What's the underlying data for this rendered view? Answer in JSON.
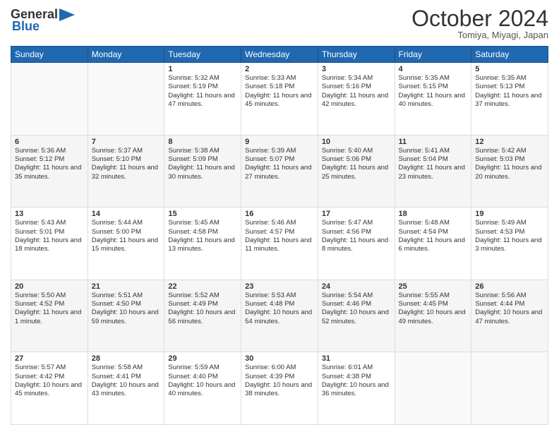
{
  "header": {
    "logo_general": "General",
    "logo_blue": "Blue",
    "month_title": "October 2024",
    "subtitle": "Tomiya, Miyagi, Japan"
  },
  "weekdays": [
    "Sunday",
    "Monday",
    "Tuesday",
    "Wednesday",
    "Thursday",
    "Friday",
    "Saturday"
  ],
  "weeks": [
    [
      {
        "day": "",
        "info": ""
      },
      {
        "day": "",
        "info": ""
      },
      {
        "day": "1",
        "info": "Sunrise: 5:32 AM\nSunset: 5:19 PM\nDaylight: 11 hours and 47 minutes."
      },
      {
        "day": "2",
        "info": "Sunrise: 5:33 AM\nSunset: 5:18 PM\nDaylight: 11 hours and 45 minutes."
      },
      {
        "day": "3",
        "info": "Sunrise: 5:34 AM\nSunset: 5:16 PM\nDaylight: 11 hours and 42 minutes."
      },
      {
        "day": "4",
        "info": "Sunrise: 5:35 AM\nSunset: 5:15 PM\nDaylight: 11 hours and 40 minutes."
      },
      {
        "day": "5",
        "info": "Sunrise: 5:35 AM\nSunset: 5:13 PM\nDaylight: 11 hours and 37 minutes."
      }
    ],
    [
      {
        "day": "6",
        "info": "Sunrise: 5:36 AM\nSunset: 5:12 PM\nDaylight: 11 hours and 35 minutes."
      },
      {
        "day": "7",
        "info": "Sunrise: 5:37 AM\nSunset: 5:10 PM\nDaylight: 11 hours and 32 minutes."
      },
      {
        "day": "8",
        "info": "Sunrise: 5:38 AM\nSunset: 5:09 PM\nDaylight: 11 hours and 30 minutes."
      },
      {
        "day": "9",
        "info": "Sunrise: 5:39 AM\nSunset: 5:07 PM\nDaylight: 11 hours and 27 minutes."
      },
      {
        "day": "10",
        "info": "Sunrise: 5:40 AM\nSunset: 5:06 PM\nDaylight: 11 hours and 25 minutes."
      },
      {
        "day": "11",
        "info": "Sunrise: 5:41 AM\nSunset: 5:04 PM\nDaylight: 11 hours and 23 minutes."
      },
      {
        "day": "12",
        "info": "Sunrise: 5:42 AM\nSunset: 5:03 PM\nDaylight: 11 hours and 20 minutes."
      }
    ],
    [
      {
        "day": "13",
        "info": "Sunrise: 5:43 AM\nSunset: 5:01 PM\nDaylight: 11 hours and 18 minutes."
      },
      {
        "day": "14",
        "info": "Sunrise: 5:44 AM\nSunset: 5:00 PM\nDaylight: 11 hours and 15 minutes."
      },
      {
        "day": "15",
        "info": "Sunrise: 5:45 AM\nSunset: 4:58 PM\nDaylight: 11 hours and 13 minutes."
      },
      {
        "day": "16",
        "info": "Sunrise: 5:46 AM\nSunset: 4:57 PM\nDaylight: 11 hours and 11 minutes."
      },
      {
        "day": "17",
        "info": "Sunrise: 5:47 AM\nSunset: 4:56 PM\nDaylight: 11 hours and 8 minutes."
      },
      {
        "day": "18",
        "info": "Sunrise: 5:48 AM\nSunset: 4:54 PM\nDaylight: 11 hours and 6 minutes."
      },
      {
        "day": "19",
        "info": "Sunrise: 5:49 AM\nSunset: 4:53 PM\nDaylight: 11 hours and 3 minutes."
      }
    ],
    [
      {
        "day": "20",
        "info": "Sunrise: 5:50 AM\nSunset: 4:52 PM\nDaylight: 11 hours and 1 minute."
      },
      {
        "day": "21",
        "info": "Sunrise: 5:51 AM\nSunset: 4:50 PM\nDaylight: 10 hours and 59 minutes."
      },
      {
        "day": "22",
        "info": "Sunrise: 5:52 AM\nSunset: 4:49 PM\nDaylight: 10 hours and 56 minutes."
      },
      {
        "day": "23",
        "info": "Sunrise: 5:53 AM\nSunset: 4:48 PM\nDaylight: 10 hours and 54 minutes."
      },
      {
        "day": "24",
        "info": "Sunrise: 5:54 AM\nSunset: 4:46 PM\nDaylight: 10 hours and 52 minutes."
      },
      {
        "day": "25",
        "info": "Sunrise: 5:55 AM\nSunset: 4:45 PM\nDaylight: 10 hours and 49 minutes."
      },
      {
        "day": "26",
        "info": "Sunrise: 5:56 AM\nSunset: 4:44 PM\nDaylight: 10 hours and 47 minutes."
      }
    ],
    [
      {
        "day": "27",
        "info": "Sunrise: 5:57 AM\nSunset: 4:42 PM\nDaylight: 10 hours and 45 minutes."
      },
      {
        "day": "28",
        "info": "Sunrise: 5:58 AM\nSunset: 4:41 PM\nDaylight: 10 hours and 43 minutes."
      },
      {
        "day": "29",
        "info": "Sunrise: 5:59 AM\nSunset: 4:40 PM\nDaylight: 10 hours and 40 minutes."
      },
      {
        "day": "30",
        "info": "Sunrise: 6:00 AM\nSunset: 4:39 PM\nDaylight: 10 hours and 38 minutes."
      },
      {
        "day": "31",
        "info": "Sunrise: 6:01 AM\nSunset: 4:38 PM\nDaylight: 10 hours and 36 minutes."
      },
      {
        "day": "",
        "info": ""
      },
      {
        "day": "",
        "info": ""
      }
    ]
  ]
}
